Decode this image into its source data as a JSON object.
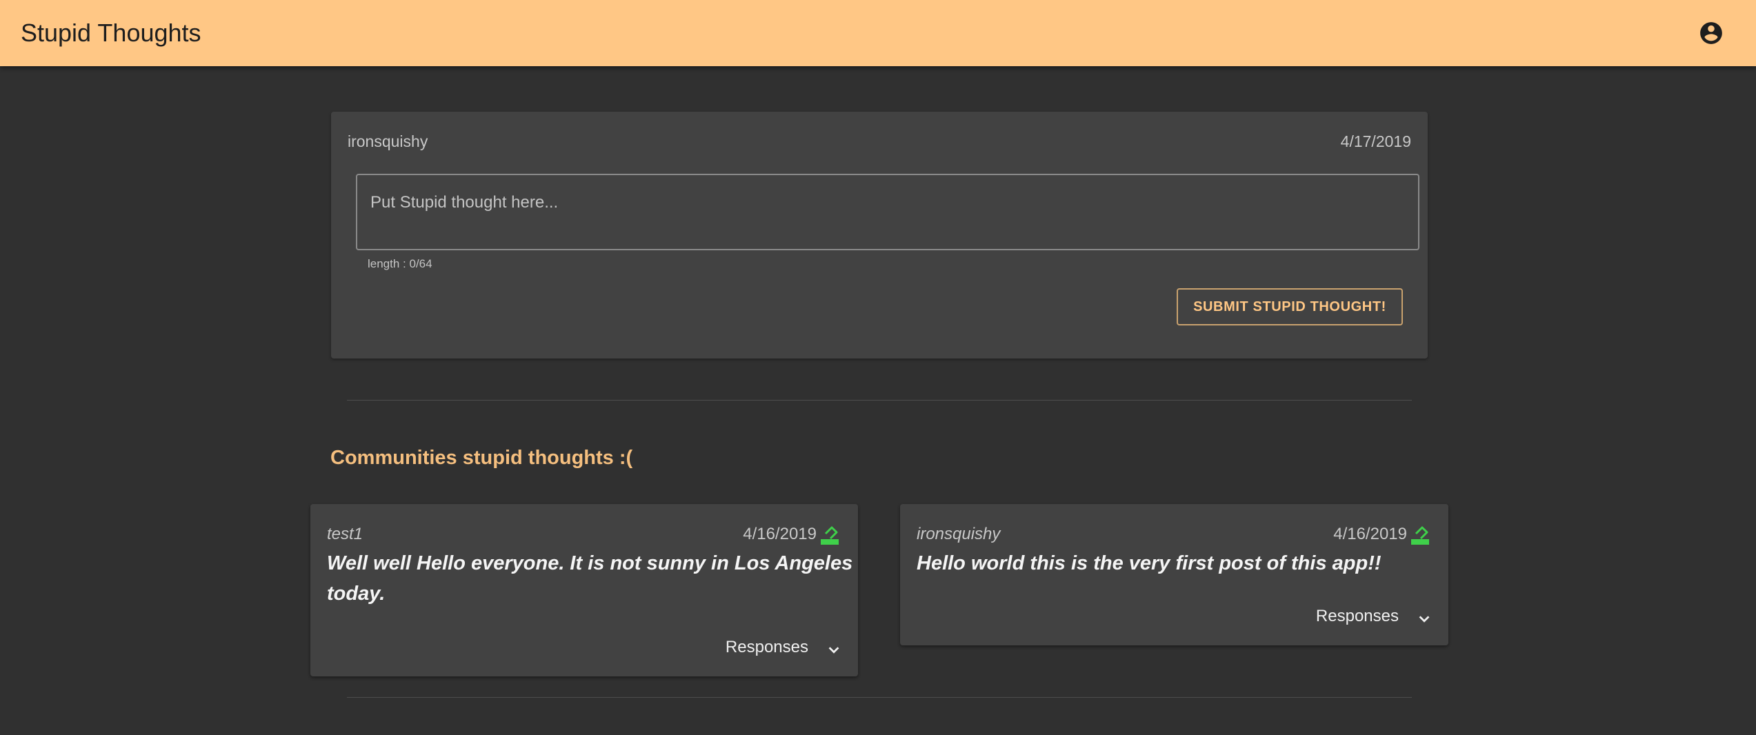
{
  "appbar": {
    "title": "Stupid Thoughts",
    "account_icon": "account-circle-icon",
    "color": "#ffc785"
  },
  "composer": {
    "username": "ironsquishy",
    "date": "4/17/2019",
    "placeholder": "Put Stupid thought here...",
    "length_hint": "length : 0/64",
    "submit_label": "SUBMIT STUPID THOUGHT!"
  },
  "feed": {
    "title": "Communities stupid thoughts :(",
    "posts": [
      {
        "author": "test1",
        "date": "4/16/2019",
        "text_line1": "Well well Hello everyone. It is not sunny in Los Angeles",
        "text_line2": "today.",
        "responses_label": "Responses",
        "action_icon": "green-edit-icon"
      },
      {
        "author": "ironsquishy",
        "date": "4/16/2019",
        "text_line1": "Hello world this is the very first post of this app!!",
        "responses_label": "Responses",
        "action_icon": "green-edit-icon"
      }
    ]
  },
  "colors": {
    "background": "#303030",
    "card": "#424242",
    "accent": "#ffc785",
    "icon_green": "#3fd04a"
  }
}
